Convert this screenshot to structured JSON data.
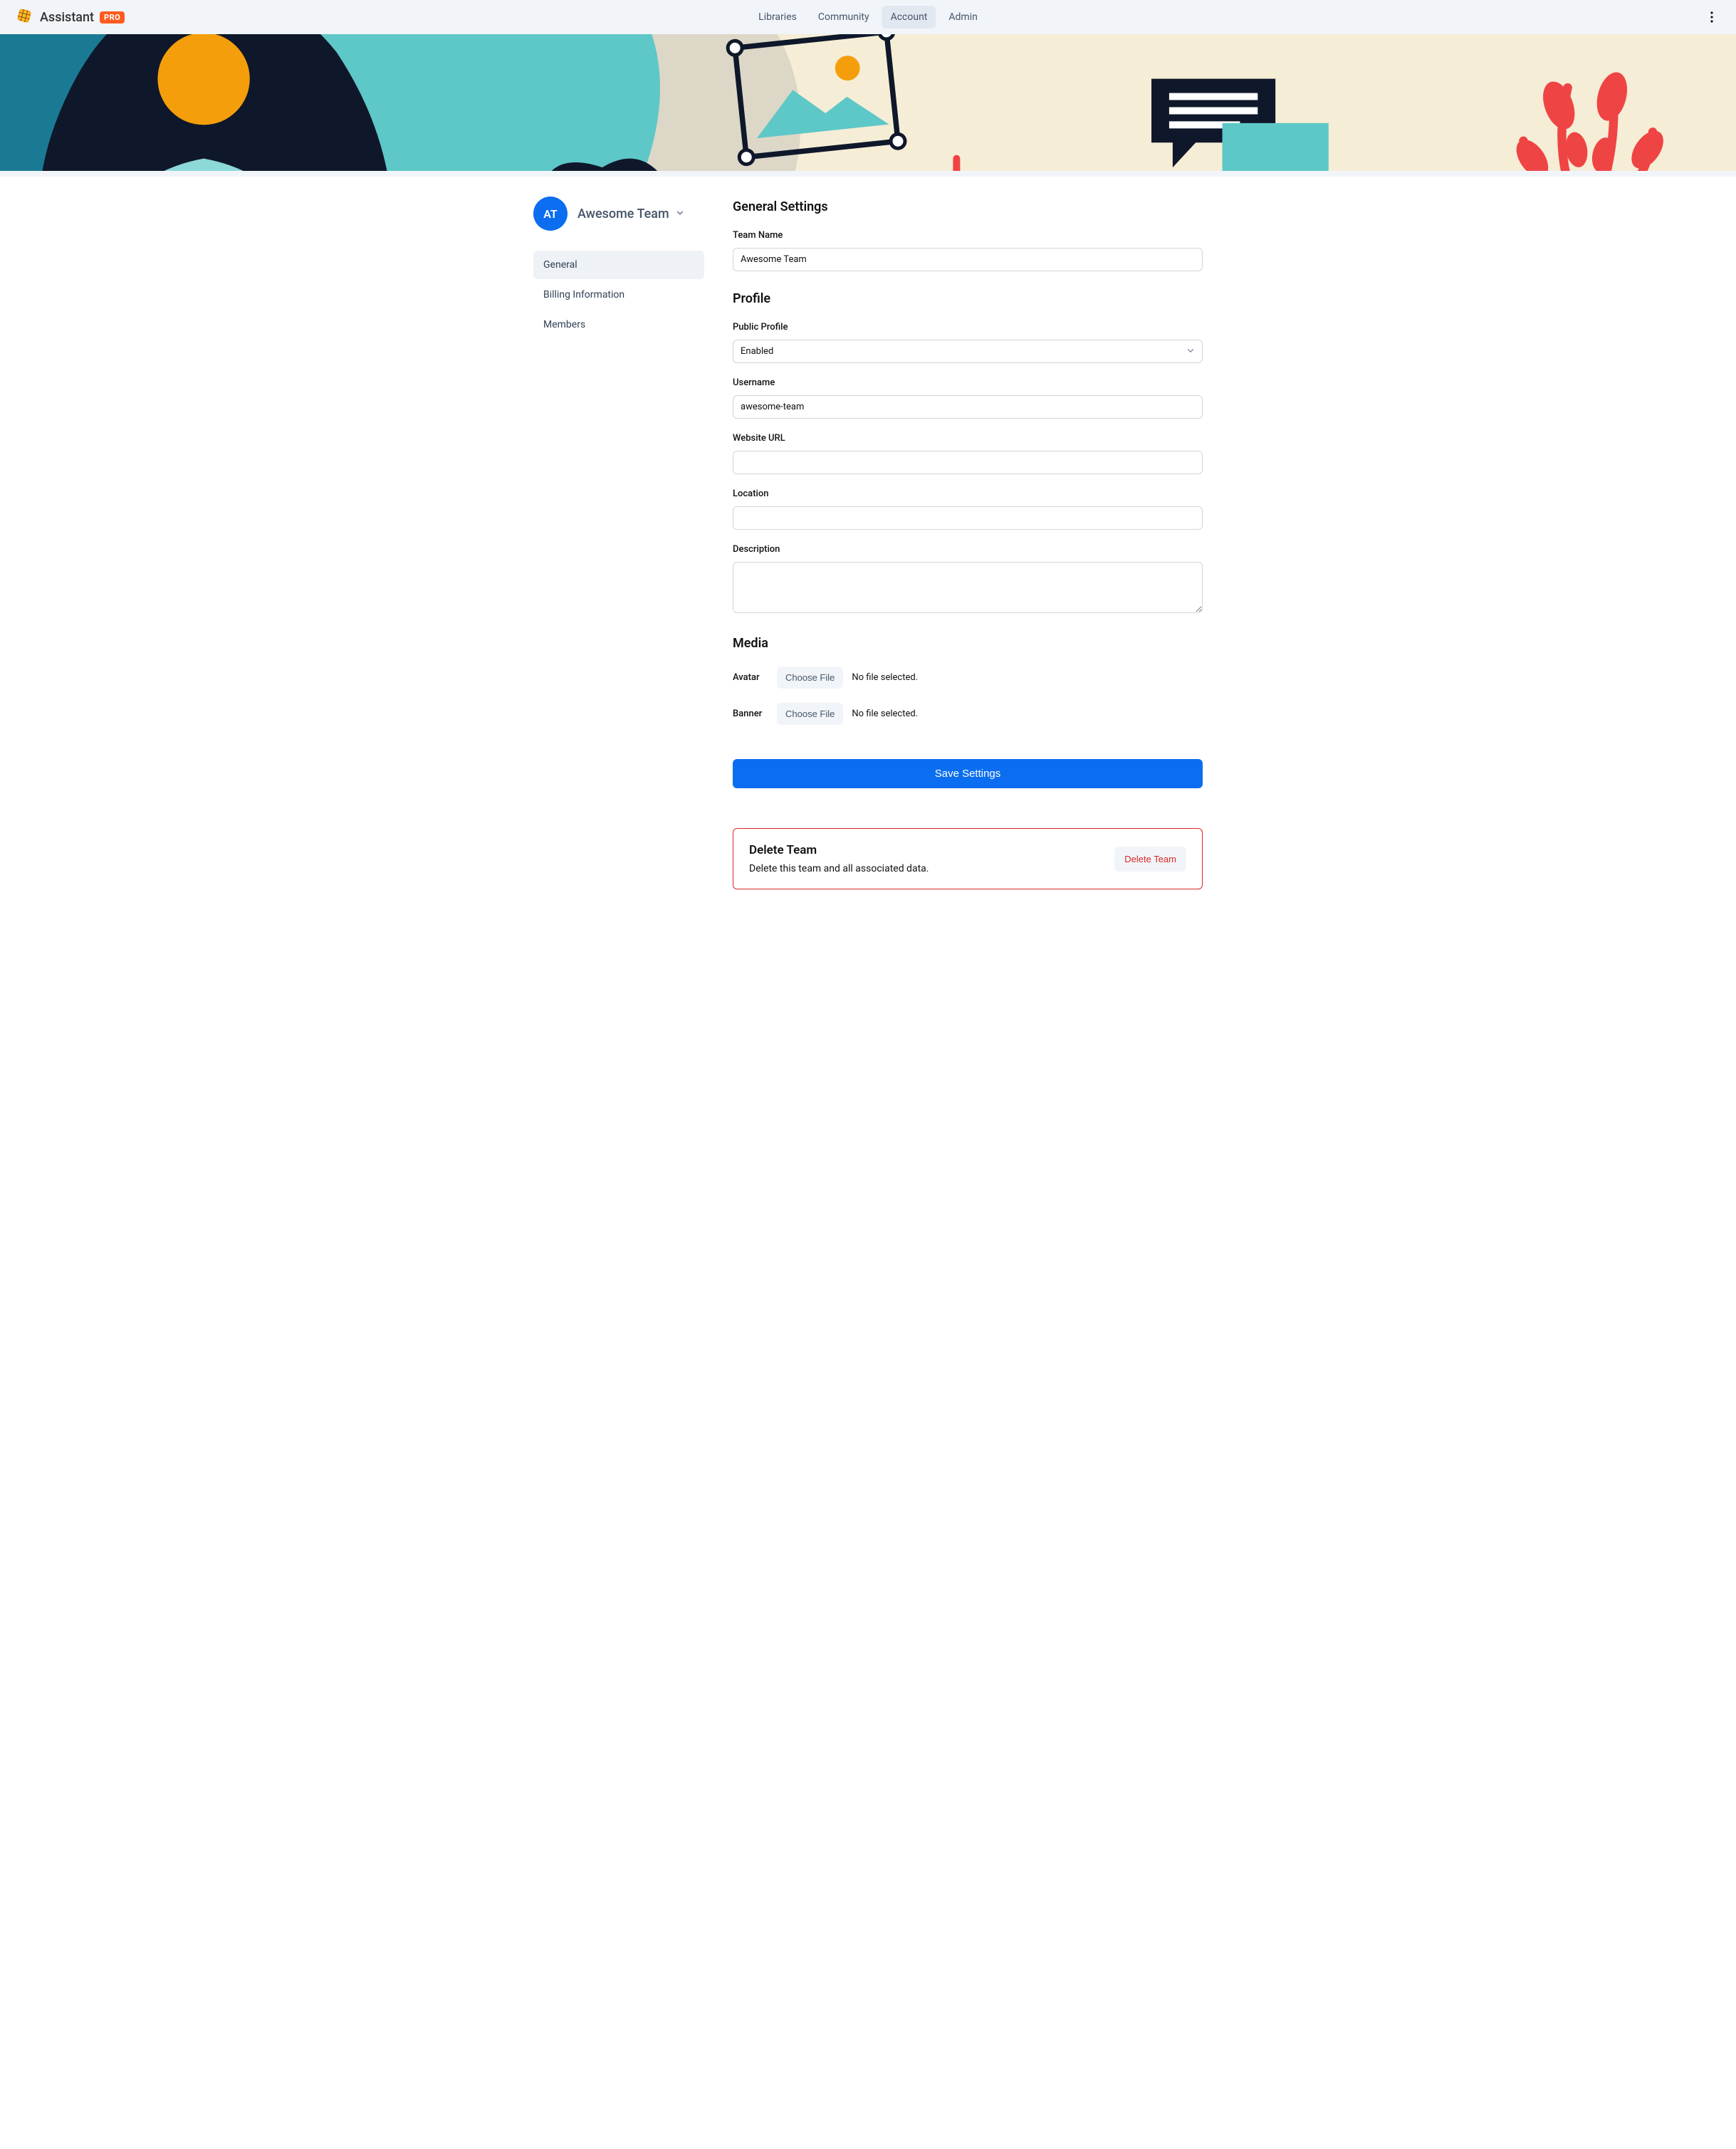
{
  "header": {
    "app_name": "Assistant",
    "pro_badge": "PRO",
    "nav": {
      "libraries": "Libraries",
      "community": "Community",
      "account": "Account",
      "admin": "Admin"
    }
  },
  "sidebar": {
    "avatar_initials": "AT",
    "team_name": "Awesome Team",
    "nav": {
      "general": "General",
      "billing": "Billing Information",
      "members": "Members"
    }
  },
  "main": {
    "general_settings_title": "General Settings",
    "team_name_label": "Team Name",
    "team_name_value": "Awesome Team",
    "profile_title": "Profile",
    "public_profile_label": "Public Profile",
    "public_profile_value": "Enabled",
    "username_label": "Username",
    "username_value": "awesome-team",
    "website_label": "Website URL",
    "website_value": "",
    "location_label": "Location",
    "location_value": "",
    "description_label": "Description",
    "description_value": "",
    "media_title": "Media",
    "avatar_label": "Avatar",
    "banner_label": "Banner",
    "choose_file_label": "Choose File",
    "no_file_selected": "No file selected.",
    "save_button": "Save Settings",
    "delete_title": "Delete Team",
    "delete_desc": "Delete this team and all associated data.",
    "delete_button": "Delete Team"
  }
}
